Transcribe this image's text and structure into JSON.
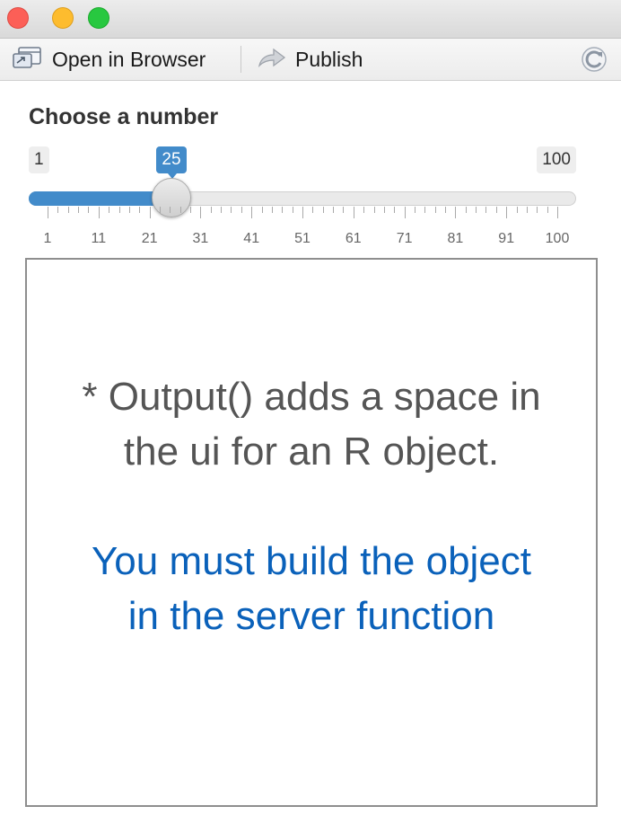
{
  "toolbar": {
    "open_in_browser": "Open in Browser",
    "publish": "Publish",
    "icons": {
      "browser": "browser-window-icon",
      "publish": "publish-arrow-icon",
      "refresh": "refresh-icon"
    }
  },
  "slider": {
    "label": "Choose a number",
    "min": "1",
    "max": "100",
    "value": "25",
    "fill_fraction": 0.24,
    "tick_labels": [
      "1",
      "11",
      "21",
      "31",
      "41",
      "51",
      "61",
      "71",
      "81",
      "91",
      "100"
    ],
    "accent_color": "#428bca"
  },
  "output": {
    "line1": "* Output() adds a space in",
    "line2": "the ui for an R object.",
    "line3": "You must build the object",
    "line4": "in the server function",
    "text_color": "#555555",
    "highlight_color": "#0a61ba"
  }
}
